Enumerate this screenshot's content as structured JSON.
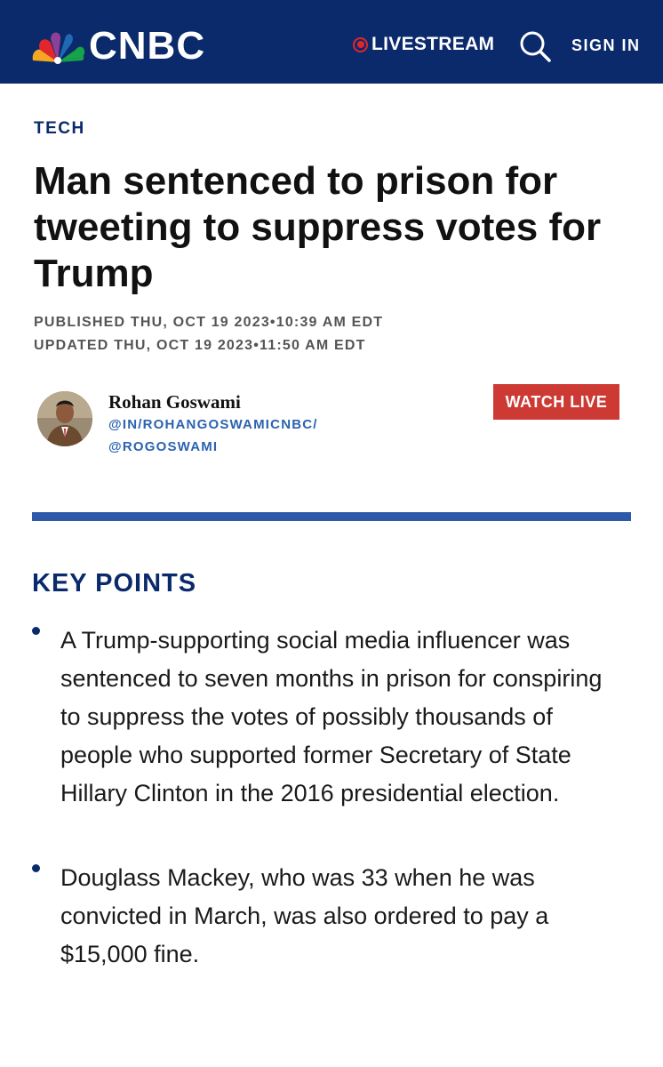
{
  "header": {
    "brand": "CNBC",
    "livestream_label": "LIVESTREAM",
    "sign_in_label": "SIGN IN",
    "colors": {
      "nav_bg": "#0b2a6b",
      "live_red": "#e0262b"
    }
  },
  "article": {
    "section": "TECH",
    "headline": "Man sentenced to prison for tweeting to suppress votes for Trump",
    "published": "PUBLISHED THU, OCT 19 2023•10:39 AM EDT",
    "updated": "UPDATED THU, OCT 19 2023•11:50 AM EDT"
  },
  "author": {
    "name": "Rohan Goswami",
    "linkedin": "@IN/ROHANGOSWAMICNBC/",
    "twitter": "@ROGOSWAMI"
  },
  "watch_live_label": "WATCH LIVE",
  "key_points": {
    "title": "KEY POINTS",
    "items": [
      "A Trump-supporting social media influencer was sentenced to seven months in prison for conspiring to suppress the votes of possibly thousands of people who supported former Secretary of State Hillary Clinton in the 2016 presidential election.",
      "Douglass Mackey, who was 33 when he was convicted in March, was also ordered to pay a $15,000 fine."
    ]
  },
  "colors": {
    "section_blue": "#0b2a6b",
    "link_blue": "#2b63b0",
    "watch_live_red": "#cc3a33",
    "divider_blue": "#2c5aa8"
  }
}
